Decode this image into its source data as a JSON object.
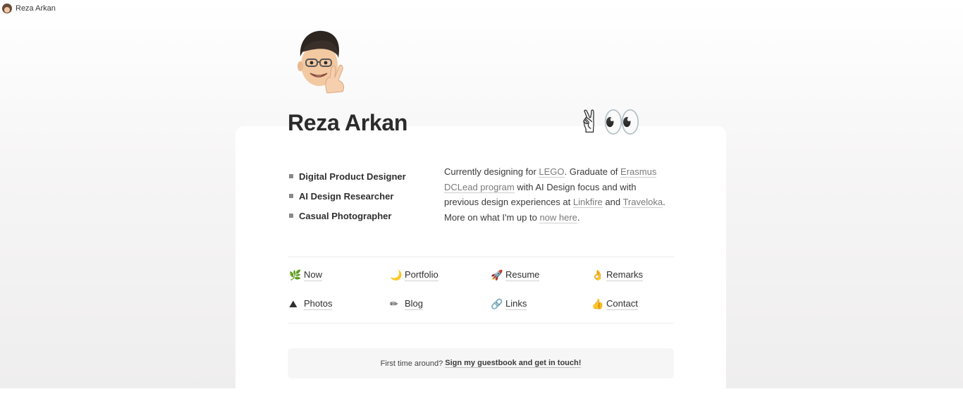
{
  "topbar": {
    "site_name": "Reza Arkan"
  },
  "header": {
    "title": "Reza Arkan",
    "title_emoji": "✌👀"
  },
  "roles": [
    "Digital Product Designer",
    "AI Design Researcher",
    "Casual Photographer"
  ],
  "bio": {
    "t1": "Currently designing for ",
    "link_lego": "LEGO",
    "t2": ". Graduate of ",
    "link_erasmus": "Erasmus DCLead program",
    "t3": " with AI Design focus and with previous design experiences at ",
    "link_linkfire": "Linkfire",
    "t4": " and ",
    "link_traveloka": "Traveloka",
    "t5": ". More on what I'm up to ",
    "link_now": "now here",
    "t6": "."
  },
  "nav": [
    {
      "emoji": "🌿",
      "label": "Now"
    },
    {
      "emoji": "🌙",
      "label": "Portfolio"
    },
    {
      "emoji": "🚀",
      "label": "Resume"
    },
    {
      "emoji": "👌",
      "label": "Remarks"
    },
    {
      "emoji": "⛰",
      "label": "Photos"
    },
    {
      "emoji": "✏",
      "label": "Blog"
    },
    {
      "emoji": "🔗",
      "label": "Links"
    },
    {
      "emoji": "👍",
      "label": "Contact"
    }
  ],
  "guestbook": {
    "prompt": "First time around?",
    "link": "Sign my guestbook and get in touch!"
  }
}
